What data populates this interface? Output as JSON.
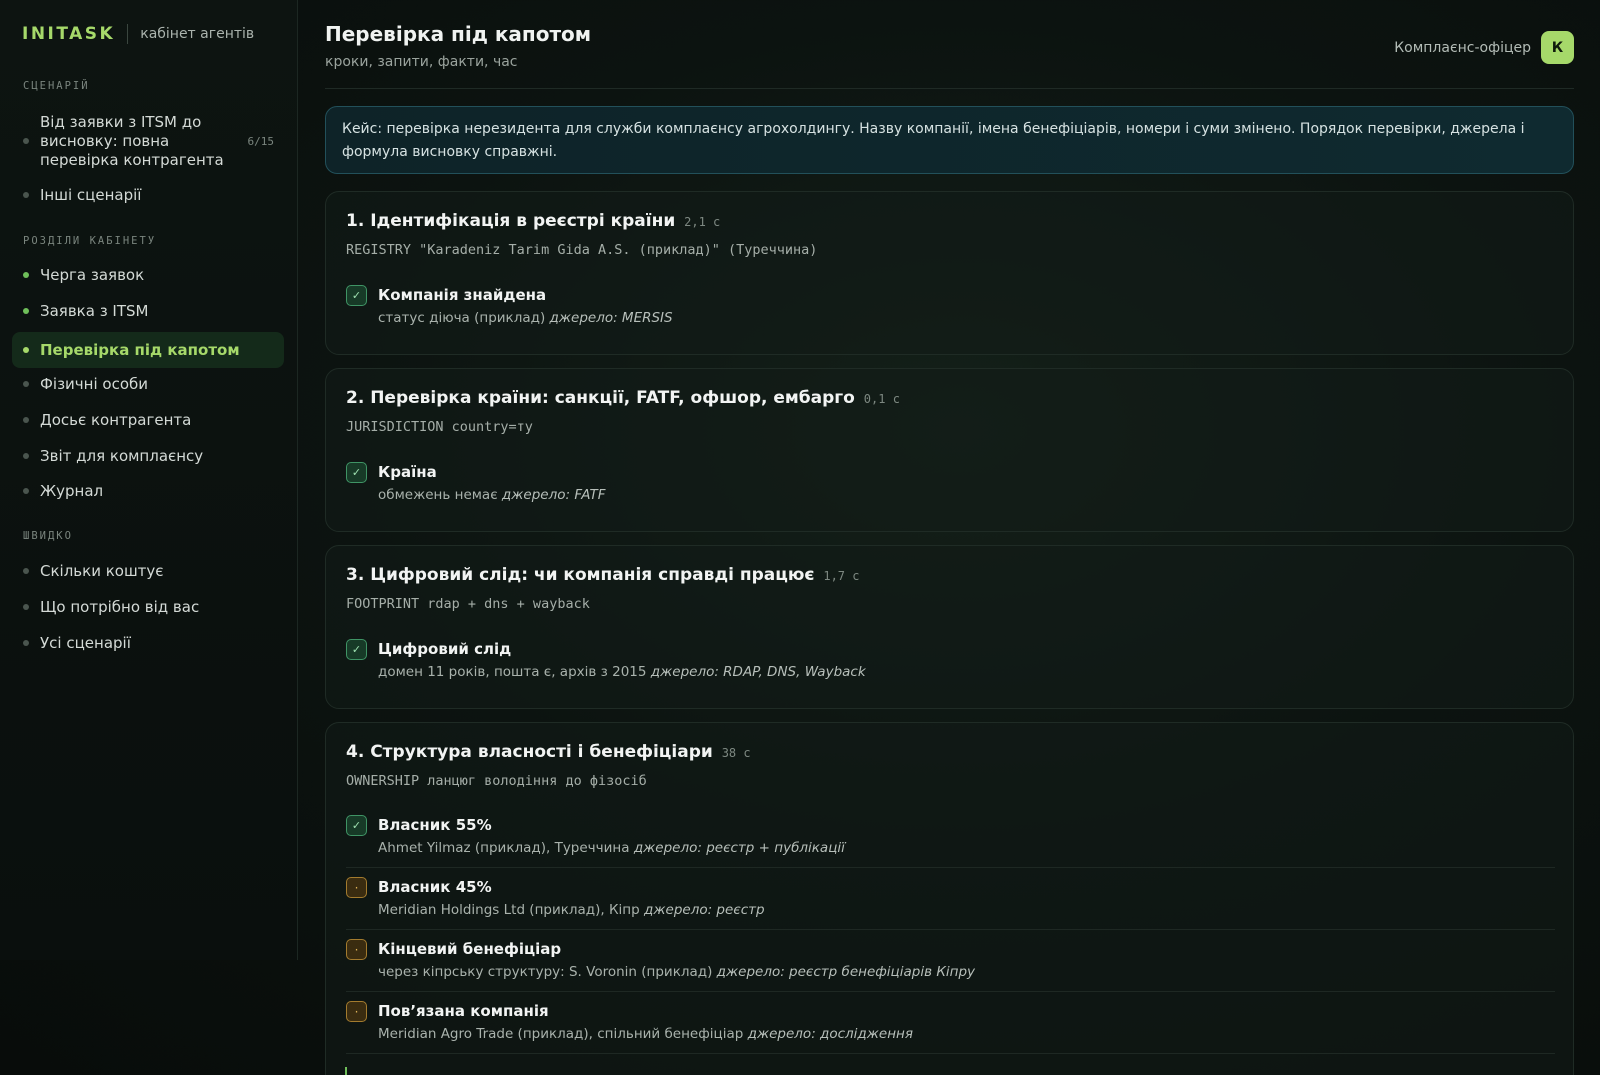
{
  "brand": {
    "logo": "INITASK",
    "subtitle": "кабінет агентів"
  },
  "sidebar": {
    "sections": {
      "scenarios": "СЦЕНАРІЙ",
      "cabinet": "РОЗДІЛИ КАБІНЕТУ",
      "quick": "ШВИДКО"
    },
    "scenario_items": [
      {
        "label": "Від заявки з ITSM до висновку: повна перевірка контрагента",
        "count": "6/15"
      },
      {
        "label": "Інші сценарії"
      }
    ],
    "cabinet_items": [
      {
        "label": "Черга заявок"
      },
      {
        "label": "Заявка з ITSM"
      },
      {
        "label": "Перевірка під капотом"
      },
      {
        "label": "Фізичні особи"
      },
      {
        "label": "Досьє контрагента"
      },
      {
        "label": "Звіт для комплаєнсу"
      },
      {
        "label": "Журнал"
      }
    ],
    "quick_items": [
      {
        "label": "Скільки коштує"
      },
      {
        "label": "Що потрібно від вас"
      },
      {
        "label": "Усі сценарії"
      }
    ]
  },
  "header": {
    "title": "Перевірка під капотом",
    "subtitle": "кроки, запити, факти, час",
    "user_role": "Комплаєнс-офіцер",
    "avatar_letter": "К"
  },
  "notice": "Кейс: перевірка нерезидента для служби комплаєнсу агрохолдингу. Назву компанії, імена бенефіціарів, номери і суми змінено. Порядок перевірки, джерела і формула висновку справжні.",
  "steps": [
    {
      "title": "1. Ідентифікація в реєстрі країни",
      "time": "2,1 с",
      "command": "REGISTRY \"Karadeniz Tarim Gida A.S. (приклад)\" (Туреччина)",
      "facts": [
        {
          "status": "ok",
          "status_glyph": "✓",
          "title": "Компанія знайдена",
          "detail": "статус діюча (приклад)",
          "source": "джерело: MERSIS"
        }
      ]
    },
    {
      "title": "2. Перевірка країни: санкції, FATF, офшор, ембарго",
      "time": "0,1 с",
      "command": "JURISDICTION country=тy",
      "facts": [
        {
          "status": "ok",
          "status_glyph": "✓",
          "title": "Країна",
          "detail": "обмежень немає",
          "source": "джерело: FATF"
        }
      ]
    },
    {
      "title": "3. Цифровий слід: чи компанія справді працює",
      "time": "1,7 с",
      "command": "FOOTPRINT rdap + dns + wayback",
      "facts": [
        {
          "status": "ok",
          "status_glyph": "✓",
          "title": "Цифровий слід",
          "detail": "домен 11 років, пошта є, архів з 2015",
          "source": "джерело: RDAP, DNS, Wayback"
        }
      ]
    },
    {
      "title": "4. Структура власності і бенефіціари",
      "time": "38 с",
      "command": "OWNERSHIP ланцюг володіння до фізосіб",
      "facts": [
        {
          "status": "ok",
          "status_glyph": "✓",
          "title": "Власник 55%",
          "detail": "Ahmet Yilmaz (приклад), Туреччина",
          "source": "джерело: реєстр + публікації"
        },
        {
          "status": "pending",
          "status_glyph": "·",
          "title": "Власник 45%",
          "detail": "Meridian Holdings Ltd (приклад), Кіпр",
          "source": "джерело: реєстр"
        },
        {
          "status": "pending",
          "status_glyph": "·",
          "title": "Кінцевий бенефіціар",
          "detail": "через кіпрську структуру: S. Voronin (приклад)",
          "source": "джерело: реєстр бенефіціарів Кіпру"
        },
        {
          "status": "pending",
          "status_glyph": "·",
          "title": "Пов’язана компанія",
          "detail": "Meridian Agro Trade (приклад), спільний бенефіціар",
          "source": "джерело: дослідження"
        }
      ]
    }
  ]
}
